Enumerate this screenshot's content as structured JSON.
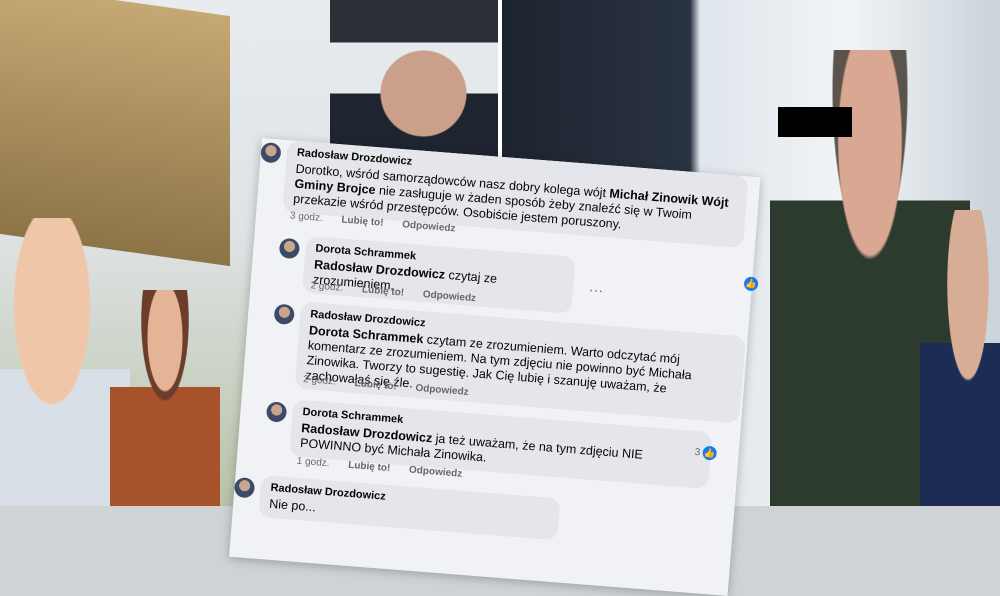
{
  "comments": [
    {
      "author": "Radosław Drozdowicz",
      "text_pre": "Dorotko, wśród samorządowców nasz dobry kolega wójt ",
      "bold_name": "Michał Zinowik Wójt Gminy Brojce",
      "text_post": " nie zasługuje w żaden sposób żeby znaleźć się w Twoim przekazie wśród przestępców. Osobiście jestem poruszony.",
      "time": "3 godz.",
      "like": "Lubię to!",
      "reply": "Odpowiedz"
    },
    {
      "author": "Dorota Schrammek",
      "bold_name": "Radosław Drozdowicz",
      "text_post": " czytaj ze zrozumieniem.",
      "time": "2 godz.",
      "like": "Lubię to!",
      "reply": "Odpowiedz",
      "more": "..."
    },
    {
      "author": "Radosław Drozdowicz",
      "bold_name": "Dorota Schrammek",
      "text_post": " czytam ze zrozumieniem. Warto odczytać mój komentarz ze zrozumieniem. Na tym zdjęciu nie powinno być Michała Zinowika. Tworzy to sugestię. Jak Cię lubię i szanuję uważam, że zachowałaś się źle.",
      "time": "2 godz.",
      "like": "Lubię to!",
      "reply": "Odpowiedz"
    },
    {
      "author": "Dorota Schrammek",
      "bold_name": "Radosław Drozdowicz",
      "text_post": " ja też uważam, że na tym zdjęciu NIE POWINNO być Michała Zinowika.",
      "time": "1 godz.",
      "like": "Lubię to!",
      "reply": "Odpowiedz",
      "like_count": "3"
    },
    {
      "author": "Radosław Drozdowicz",
      "text_post": "Nie po..."
    }
  ],
  "colors": {
    "facebook_blue": "#1877f2",
    "bubble": "#e4e6eb",
    "censor": "#000000"
  }
}
